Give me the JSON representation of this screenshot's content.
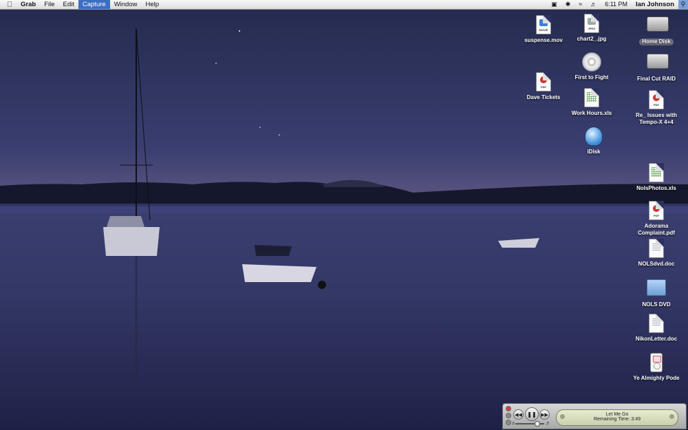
{
  "menubar": {
    "apple_icon": "apple-icon",
    "app_name": "Grab",
    "items": [
      "File",
      "Edit",
      "Capture",
      "Window",
      "Help"
    ],
    "active_item": "Capture",
    "clock": "6:11 PM",
    "user": "Ian Johnson"
  },
  "desktop_icons": [
    {
      "label": "suspense.mov",
      "kind": "movie"
    },
    {
      "label": "chart2_.jpg",
      "kind": "jpeg"
    },
    {
      "label": "Home Disk",
      "kind": "disk",
      "selected": true
    },
    {
      "label": "First to Fight",
      "kind": "dvd"
    },
    {
      "label": "Final Cut RAID",
      "kind": "disk"
    },
    {
      "label": "Dave Tickets",
      "kind": "pdf"
    },
    {
      "label": "Work Hours.xls",
      "kind": "xls"
    },
    {
      "label": "Re_ Issues with Tempo-X 4+4",
      "kind": "pdf"
    },
    {
      "label": "iDisk",
      "kind": "idisk"
    },
    {
      "label": "NolsPhotos.xls",
      "kind": "xls"
    },
    {
      "label": "Adorama Complaint.pdf",
      "kind": "pdf"
    },
    {
      "label": "NOLSdvd.doc",
      "kind": "doc"
    },
    {
      "label": "NOLS DVD",
      "kind": "folder"
    },
    {
      "label": "NikonLetter.doc",
      "kind": "doc"
    },
    {
      "label": "Ye Almighty Pode",
      "kind": "ipod"
    }
  ],
  "mini_player": {
    "track": "Let Me Go",
    "remaining": "Remaining Time: 3:49"
  },
  "colors": {
    "menu_highlight": "#3b6fc2",
    "sky": "#2f3560",
    "water": "#2e3260"
  }
}
